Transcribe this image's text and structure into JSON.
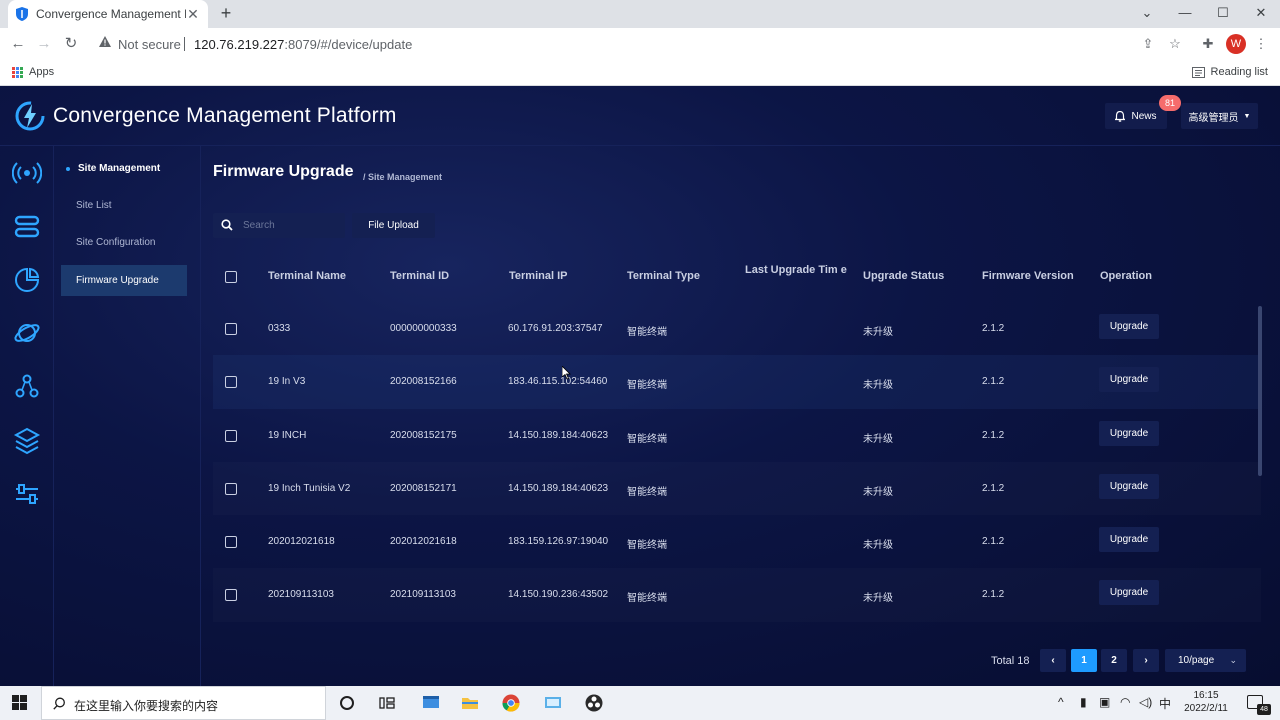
{
  "browser": {
    "tab_title": "Convergence Management Pl",
    "security_label": "Not secure",
    "url_host": "120.76.219.227",
    "url_rest": ":8079/#/device/update",
    "profile_initial": "W",
    "bookmark_apps": "Apps",
    "reading_list": "Reading list"
  },
  "app": {
    "title": "Convergence Management Platform",
    "news_label": "News",
    "news_count": "81",
    "user_label": "高级管理员"
  },
  "sidenav": {
    "group": "Site Management",
    "items": [
      {
        "label": "Site List"
      },
      {
        "label": "Site Configuration"
      },
      {
        "label": "Firmware Upgrade"
      }
    ]
  },
  "page": {
    "title": "Firmware Upgrade",
    "breadcrumb": "/ Site Management"
  },
  "toolbar": {
    "search_placeholder": "Search",
    "upload_label": "File Upload"
  },
  "table": {
    "columns": [
      "Terminal Name",
      "Terminal ID",
      "Terminal IP",
      "Terminal Type",
      "Last Upgrade Tim e",
      "Upgrade Status",
      "Firmware Version",
      "Operation"
    ],
    "rows": [
      {
        "name": "0333",
        "id": "000000000333",
        "ip": "60.176.91.203:37547",
        "type": "智能终端",
        "last": "",
        "status": "未升级",
        "version": "2.1.2",
        "op": "Upgrade"
      },
      {
        "name": "19 In V3",
        "id": "202008152166",
        "ip": "183.46.115.102:54460",
        "type": "智能终端",
        "last": "",
        "status": "未升级",
        "version": "2.1.2",
        "op": "Upgrade"
      },
      {
        "name": "19 INCH",
        "id": "202008152175",
        "ip": "14.150.189.184:40623",
        "type": "智能终端",
        "last": "",
        "status": "未升级",
        "version": "2.1.2",
        "op": "Upgrade"
      },
      {
        "name": "19 Inch Tunisia V2",
        "id": "202008152171",
        "ip": "14.150.189.184:40623",
        "type": "智能终端",
        "last": "",
        "status": "未升级",
        "version": "2.1.2",
        "op": "Upgrade"
      },
      {
        "name": "202012021618",
        "id": "202012021618",
        "ip": "183.159.126.97:19040",
        "type": "智能终端",
        "last": "",
        "status": "未升级",
        "version": "2.1.2",
        "op": "Upgrade"
      },
      {
        "name": "202109113103",
        "id": "202109113103",
        "ip": "14.150.190.236:43502",
        "type": "智能终端",
        "last": "",
        "status": "未升级",
        "version": "2.1.2",
        "op": "Upgrade"
      }
    ]
  },
  "pagination": {
    "total": "Total 18",
    "pages": [
      "1",
      "2"
    ],
    "current": "1",
    "per_page": "10/page"
  },
  "taskbar": {
    "search_placeholder": "在这里输入你要搜索的内容",
    "ime": "中",
    "time": "16:15",
    "date": "2022/2/11",
    "notifications": "48"
  },
  "colors": {
    "app_bg": "#0a1238",
    "accent": "#1e9bff",
    "badge": "#f56c6c"
  }
}
